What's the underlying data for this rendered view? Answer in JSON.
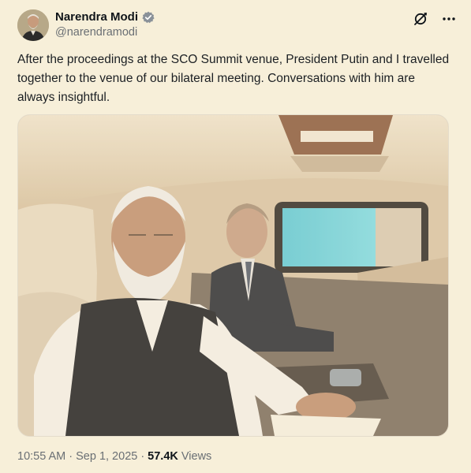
{
  "author": {
    "name": "Narendra Modi",
    "handle": "@narendramodi",
    "verified": true,
    "avatar_icon": "user-avatar"
  },
  "post": {
    "text": "After the proceedings at the SCO Summit venue, President Putin and I travelled together to the venue of our bilateral meeting. Conversations with him are always insightful.",
    "media_alt": "Photo of two men seated in the back of a car",
    "time": "10:55 AM",
    "date": "Sep 1, 2025",
    "separator": "·",
    "views_count": "57.4K",
    "views_label": "Views"
  },
  "icons": {
    "grok": "grok-icon",
    "more": "more-icon",
    "verified": "verified-badge-icon"
  },
  "colors": {
    "background": "#f7efd9",
    "verified_badge": "#8a9199",
    "secondary_text": "#6a6f74"
  }
}
